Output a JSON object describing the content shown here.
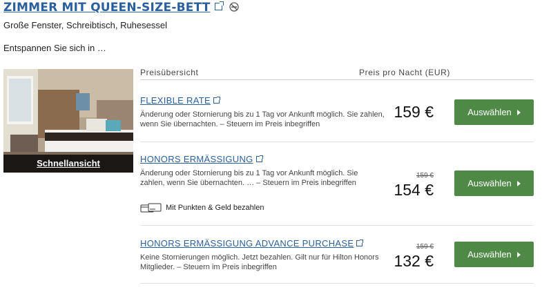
{
  "room": {
    "title": "ZIMMER MIT QUEEN-SIZE-BETT",
    "description": "Große Fenster, Schreibtisch, Ruhesessel",
    "relax_text": "Entspannen Sie sich in …",
    "quick_view_label": "Schnellansicht"
  },
  "table_header": {
    "rate_overview": "Preisübersicht",
    "price_per_night": "Preis pro Nacht (EUR)"
  },
  "rates": [
    {
      "name": "FLEXIBLE RATE",
      "description": "Änderung oder Stornierung bis zu 1 Tag vor Ankunft möglich. Sie zahlen, wenn Sie übernachten. – Steuern im Preis inbegriffen",
      "old_price": "",
      "price": "159 €",
      "button": "Auswählen"
    },
    {
      "name": "HONORS ERMÄSSIGUNG",
      "description": "Änderung oder Stornierung bis zu 1 Tag vor Ankunft möglich. Sie zahlen, wenn Sie übernachten. … – Steuern im Preis inbegriffen",
      "old_price": "159 €",
      "price": "154 €",
      "button": "Auswählen",
      "points_label": "Mit Punkten & Geld bezahlen"
    },
    {
      "name": "HONORS ERMÄSSIGUNG ADVANCE PURCHASE",
      "description": "Keine Stornierungen möglich. Jetzt bezahlen. Gilt nur für Hilton Honors Mitglieder. – Steuern im Preis inbegriffen",
      "old_price": "159 €",
      "price": "132 €",
      "button": "Auswählen"
    }
  ],
  "colors": {
    "link": "#2a5f9e",
    "button": "#4e8a46"
  },
  "icons": {
    "external": "external-link-icon",
    "no_smoking": "no-smoking-icon",
    "points": "points-money-icon",
    "arrow": "arrow-right-icon"
  }
}
